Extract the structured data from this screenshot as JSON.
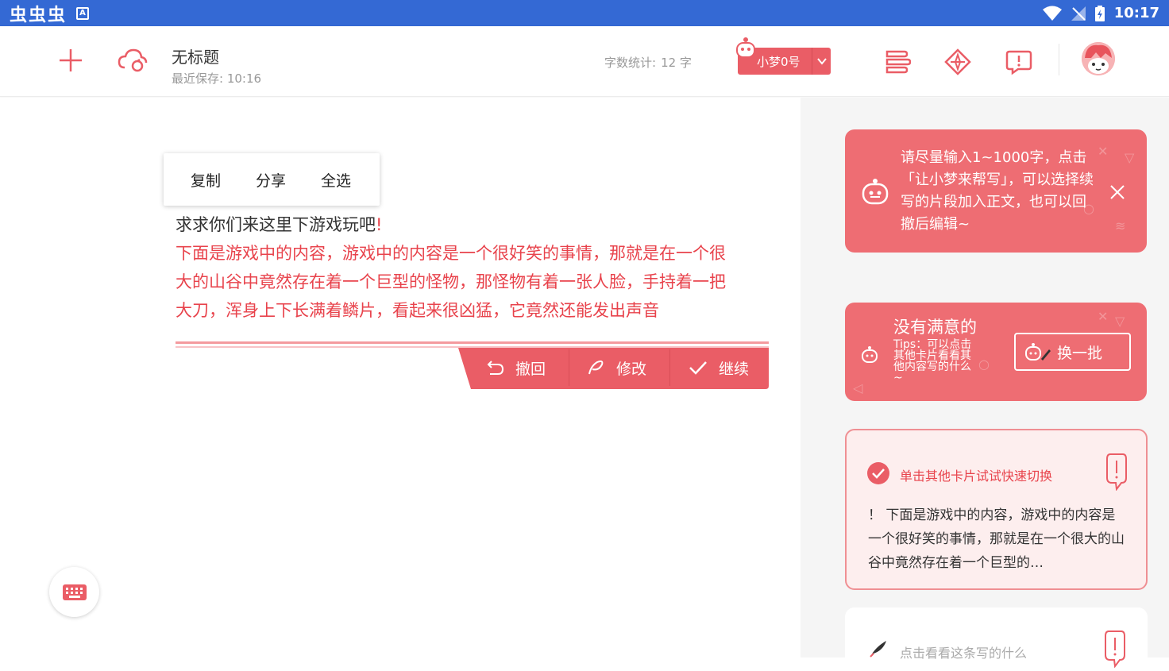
{
  "status_bar": {
    "left_glyphs": "虫虫虫",
    "a_glyph": "A",
    "time": "10:17"
  },
  "toolbar": {
    "doc_title": "无标题",
    "last_saved": "最近保存: 10:16",
    "word_count_label": "字数统计:",
    "word_count_value": "12 字",
    "robot_label": "小梦0号"
  },
  "context_menu": {
    "copy": "复制",
    "share": "分享",
    "select_all": "全选"
  },
  "editor": {
    "first_line": "求求你们来这里下游戏玩吧",
    "first_line_mark": "!",
    "generated": [
      "下面是游戏中的内容，游戏中的内容是一个很好笑的事情，那就是在一个很",
      "大的山谷中竟然存在着一个巨型的怪物，那怪物有着一张人脸，手持着一把",
      "大刀，浑身上下长满着鳞片，看起来很凶猛，它竟然还能发出声音"
    ]
  },
  "action_bar": {
    "undo": "撤回",
    "edit": "修改",
    "continue": "继续"
  },
  "side": {
    "tip_text": "请尽量输入1~1000字，点击「让小梦来帮写」，可以选择续写的片段加入正文，也可以回撤后编辑~",
    "batch_title": "没有满意的",
    "batch_tips": "Tips：可以点击其他卡片看看其他内容写的什么~",
    "batch_button": "换一批",
    "option1_hint": "单击其他卡片试试快速切换",
    "option1_text": "！ 下面是游戏中的内容，游戏中的内容是一个很好笑的事情，那就是在一个很大的山谷中竟然存在着一个巨型的…",
    "option2_hint": "点击看看这条写的什么"
  },
  "colors": {
    "accent": "#ea5d66",
    "status_bar": "#3469d4",
    "text_red": "#e8434c"
  }
}
